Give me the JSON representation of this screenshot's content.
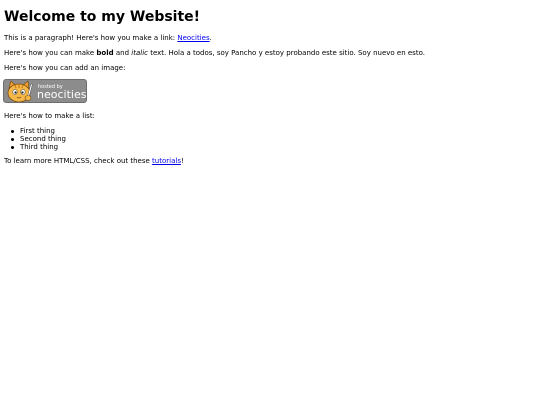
{
  "heading": "Welcome to my Website!",
  "para1": {
    "text": "This is a paragraph! Here's how you make a link: ",
    "link": "Neocities",
    "end": "."
  },
  "para2": {
    "start": "Here's how you can make ",
    "bold": "bold",
    "mid": " and ",
    "italic": "italic",
    "end": " text. Hola a todos, soy Pancho y estoy probando este sitio. Soy nuevo en esto."
  },
  "para3": "Here's how you can add an image:",
  "badge": {
    "hosted": "hosted by",
    "brand": "neocities"
  },
  "para4": "Here's how to make a list:",
  "list": [
    "First thing",
    "Second thing",
    "Third thing"
  ],
  "para5": {
    "text": "To learn more HTML/CSS, check out these ",
    "link": "tutorials",
    "end": "!"
  },
  "colors": {
    "link": "#0000ee",
    "badge_bg": "#8c8c8c",
    "cat_orange": "#f0a030"
  },
  "icons": {
    "badge_mascot": "neocities-cat-icon"
  }
}
